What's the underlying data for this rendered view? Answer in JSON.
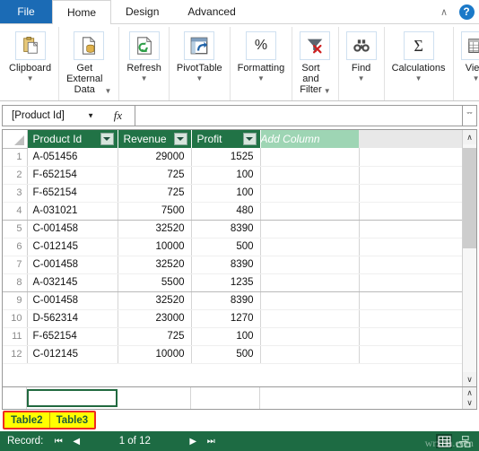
{
  "window": {
    "tabs": [
      {
        "id": "file",
        "label": "File",
        "active": false
      },
      {
        "id": "home",
        "label": "Home",
        "active": true
      },
      {
        "id": "design",
        "label": "Design",
        "active": false
      },
      {
        "id": "advanced",
        "label": "Advanced",
        "active": false
      }
    ],
    "collapse_glyph": "∧",
    "help_glyph": "?"
  },
  "ribbon": {
    "groups": [
      {
        "name": "clipboard",
        "label": "Clipboard",
        "icon": "clipboard-icon",
        "caret": true
      },
      {
        "name": "get-external-data",
        "label": "Get External\nData",
        "icon": "external-data-icon",
        "caret": true
      },
      {
        "name": "refresh",
        "label": "Refresh",
        "icon": "refresh-icon",
        "caret": true
      },
      {
        "name": "pivottable",
        "label": "PivotTable",
        "icon": "pivottable-icon",
        "caret": true
      },
      {
        "name": "formatting",
        "label": "Formatting",
        "icon": "percent-icon",
        "caret": true
      },
      {
        "name": "sort-and-filter",
        "label": "Sort and\nFilter",
        "icon": "sort-filter-icon",
        "caret": true
      },
      {
        "name": "find",
        "label": "Find",
        "icon": "binoculars-icon",
        "caret": true
      },
      {
        "name": "calculations",
        "label": "Calculations",
        "icon": "sigma-icon",
        "caret": true
      },
      {
        "name": "view",
        "label": "View",
        "icon": "grid-view-icon",
        "caret": true
      }
    ]
  },
  "formula_bar": {
    "name_box_value": "[Product Id]",
    "name_box_caret": "▼",
    "fx_label": "fx",
    "formula_value": "",
    "formula_placeholder": "",
    "expand_glyph": "ˇˇ"
  },
  "grid": {
    "columns": [
      {
        "key": "product_id",
        "label": "Product Id",
        "filter": true,
        "align": "left"
      },
      {
        "key": "revenue",
        "label": "Revenue",
        "filter": true,
        "align": "right"
      },
      {
        "key": "profit",
        "label": "Profit",
        "filter": true,
        "align": "right"
      }
    ],
    "add_column_label": "Add Column",
    "rows": [
      {
        "n": "1",
        "product_id": "A-051456",
        "revenue": "29000",
        "profit": "1525"
      },
      {
        "n": "2",
        "product_id": "F-652154",
        "revenue": "725",
        "profit": "100"
      },
      {
        "n": "3",
        "product_id": "F-652154",
        "revenue": "725",
        "profit": "100"
      },
      {
        "n": "4",
        "product_id": "A-031021",
        "revenue": "7500",
        "profit": "480"
      },
      {
        "n": "5",
        "product_id": "C-001458",
        "revenue": "32520",
        "profit": "8390"
      },
      {
        "n": "6",
        "product_id": "C-012145",
        "revenue": "10000",
        "profit": "500"
      },
      {
        "n": "7",
        "product_id": "C-001458",
        "revenue": "32520",
        "profit": "8390"
      },
      {
        "n": "8",
        "product_id": "A-032145",
        "revenue": "5500",
        "profit": "1235"
      },
      {
        "n": "9",
        "product_id": "C-001458",
        "revenue": "32520",
        "profit": "8390"
      },
      {
        "n": "10",
        "product_id": "D-562314",
        "revenue": "23000",
        "profit": "1270"
      },
      {
        "n": "11",
        "product_id": "F-652154",
        "revenue": "725",
        "profit": "100"
      },
      {
        "n": "12",
        "product_id": "C-012145",
        "revenue": "10000",
        "profit": "500"
      }
    ],
    "scroll_up_glyph": "∧",
    "scroll_down_glyph": "∨"
  },
  "sheet_tabs": {
    "items": [
      {
        "label": "Table2",
        "active": true
      },
      {
        "label": "Table3",
        "active": false
      }
    ],
    "highlight_color": "#ee2b22",
    "tab_color": "#ffff00"
  },
  "status_bar": {
    "record_label": "Record:",
    "first_glyph": "⏮",
    "prev_glyph": "◀",
    "position_text": "1 of 12",
    "next_glyph": "▶",
    "last_glyph": "⏭",
    "view_icons": [
      "grid-view-icon",
      "diagram-view-icon"
    ],
    "watermark": "wrxdn.com"
  },
  "colors": {
    "accent_green": "#217346",
    "header_green": "#217346",
    "add_column_green": "#9ed5b4",
    "status_green": "#1d6b43",
    "file_blue": "#1b6bb5",
    "tab_yellow": "#ffff00",
    "highlight_red": "#ee2b22"
  }
}
